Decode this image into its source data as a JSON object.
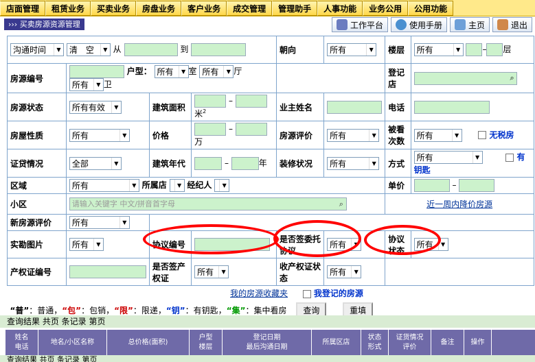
{
  "nav": [
    "店面管理",
    "租赁业务",
    "买卖业务",
    "房盘业务",
    "客户业务",
    "成交管理",
    "管理助手",
    "人事功能",
    "业务公用",
    "公用功能"
  ],
  "breadcrumb": "››› 买卖房源资源管理",
  "tools": [
    "工作平台",
    "使用手册",
    "主页",
    "退出"
  ],
  "form": {
    "r1": {
      "sel_a": "沟通时间",
      "sel_b": "清　空",
      "from": "从",
      "to": "到",
      "chaoxiang": "朝向",
      "chaoxiang_v": "所有",
      "louceng": "楼层",
      "louceng_v": "所有",
      "ceng": "层"
    },
    "r2": {
      "fybh": "房源编号",
      "huxing": "户型：",
      "shi_v": "所有",
      "shi": "室",
      "ting_v": "所有",
      "ting": "厅",
      "wei_v": "所有",
      "wei": "卫",
      "djd": "登记店"
    },
    "r3": {
      "fyzt": "房源状态",
      "fyzt_v": "所有有效",
      "jzmj": "建筑面积",
      "mi": "米",
      "sup": "2",
      "yzxm": "业主姓名",
      "dianhua": "电话"
    },
    "r4": {
      "fwxz": "房屋性质",
      "fwxz_v": "所有",
      "jiage": "价格",
      "wan": "万",
      "fypj": "房源评价",
      "fypj_v": "所有",
      "bkcs": "被看次数",
      "bkcs_v": "所有",
      "wsf": "无税房"
    },
    "r5": {
      "zdqk": "证贷情况",
      "zdqk_v": "全部",
      "jznd": "建筑年代",
      "nian": "年",
      "zxzk": "装修状况",
      "zxzk_v": "所有",
      "fangshi": "方式",
      "fangshi_v": "所有",
      "youyaoshi": "有钥匙"
    },
    "r6": {
      "quyu": "区域",
      "quyu_v": "所有",
      "ssd": "所属店",
      "jjr": "经纪人",
      "danjia": "单价"
    },
    "r7": {
      "xiaoqu": "小区",
      "xiaoqu_ph": "请输入关键字 中文/拼音首字母",
      "jiangjia": "近一周内降价房源"
    },
    "r8": {
      "xfypj": "新房源评价",
      "xfypj_v": "所有"
    },
    "r9": {
      "sktp": "实勘图片",
      "sktp_v": "所有",
      "xybh": "协议编号",
      "sfqwt": "是否签委托协议",
      "sfqwt_v": "所有",
      "xyzt": "协议状态",
      "xyzt_v": "所有"
    },
    "r10": {
      "cqzbh": "产权证编号",
      "sfqcq": "是否签产权证",
      "sfqcq_v": "所有",
      "sqzzt": "收产权证状态",
      "sqzzt_v": "所有"
    },
    "r11": {
      "shoucang": "我的房源收藏夹",
      "wodengji": "我登记的房源"
    },
    "legend": [
      {
        "k": "“普”",
        "v": "：普通，",
        "c": "#000"
      },
      {
        "k": "“包”",
        "v": "：包销，",
        "c": "#cc0000"
      },
      {
        "k": "“限”",
        "v": "：限递，",
        "c": "#cc0000"
      },
      {
        "k": "“钥”",
        "v": "：有钥匙，",
        "c": "#0033cc"
      },
      {
        "k": "“集”",
        "v": "：集中看房",
        "c": "#009900"
      }
    ],
    "query_btn": "查询",
    "reset_btn": "重填"
  },
  "result_bar": "查询结果 共页 条记录 第页",
  "headers": [
    [
      "姓名",
      "电话"
    ],
    [
      "地名/小区名称"
    ],
    [
      "总价格(面积)"
    ],
    [
      "户型",
      "楼层"
    ],
    [
      "登记日期",
      "最后沟通日期"
    ],
    [
      "所属区店"
    ],
    [
      "状态",
      "形式"
    ],
    [
      "证货情况",
      "评价"
    ],
    [
      "备注"
    ],
    [
      "操作"
    ]
  ],
  "result_bar2": "查询结果 共页 条记录 第页"
}
